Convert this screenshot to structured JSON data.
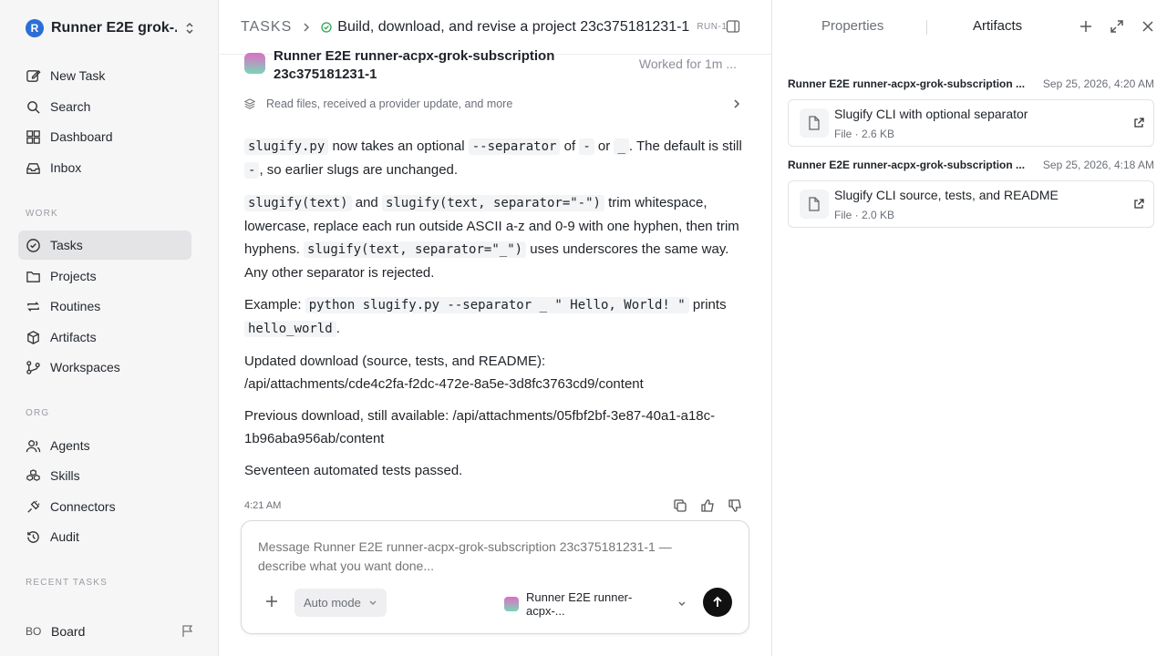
{
  "workspace": {
    "logo_letter": "R",
    "name": "Runner E2E grok-..."
  },
  "nav": {
    "new_task": "New Task",
    "search": "Search",
    "dashboard": "Dashboard",
    "inbox": "Inbox"
  },
  "sections": {
    "work": "WORK",
    "org": "ORG",
    "recent": "RECENT TASKS"
  },
  "work_nav": {
    "tasks": "Tasks",
    "projects": "Projects",
    "routines": "Routines",
    "artifacts": "Artifacts",
    "workspaces": "Workspaces"
  },
  "org_nav": {
    "agents": "Agents",
    "skills": "Skills",
    "connectors": "Connectors",
    "audit": "Audit"
  },
  "board": {
    "avatar": "BO",
    "label": "Board"
  },
  "header": {
    "crumb": "TASKS",
    "title": "Build, download, and revise a project 23c375181231-1",
    "run_id": "RUN-1"
  },
  "message": {
    "agent_name": "Runner E2E runner-acpx-grok-subscription 23c375181231-1",
    "worked_for": "Worked for 1m ...",
    "activity": "Read files, received a provider update, and more",
    "p1": {
      "c1": "slugify.py",
      "t1": " now takes an optional ",
      "c2": "--separator",
      "t2": " of ",
      "c3": "-",
      "t3": " or ",
      "c4": "_",
      "t4": ". The default is still ",
      "c5": "-",
      "t5": ", so earlier slugs are unchanged."
    },
    "p2": {
      "c1": "slugify(text)",
      "t1": " and ",
      "c2": "slugify(text, separator=\"-\")",
      "t2": " trim whitespace, lowercase, replace each run outside ASCII a-z and 0-9 with one hyphen, then trim hyphens. ",
      "c3": "slugify(text, separator=\"_\")",
      "t3": " uses underscores the same way. Any other separator is rejected."
    },
    "p3": {
      "t1": "Example: ",
      "c1": "python slugify.py --separator _ \" Hello, World! \"",
      "t2": " prints ",
      "c2": "hello_world",
      "t3": "."
    },
    "p4": {
      "line1": "Updated download (source, tests, and README):",
      "line2": "/api/attachments/cde4c2fa-f2dc-472e-8a5e-3d8fc3763cd9/content"
    },
    "p5": "Previous download, still available: /api/attachments/05fbf2bf-3e87-40a1-a18c-1b96aba956ab/content",
    "p6": "Seventeen automated tests passed.",
    "timestamp": "4:21 AM"
  },
  "composer": {
    "placeholder": "Message Runner E2E runner-acpx-grok-subscription 23c375181231-1 — describe what you want done...",
    "mode": "Auto mode",
    "agent": "Runner E2E runner-acpx-..."
  },
  "right_panel": {
    "tab_properties": "Properties",
    "tab_artifacts": "Artifacts",
    "artifacts": [
      {
        "owner": "Runner E2E runner-acpx-grok-subscription ...",
        "date": "Sep 25, 2026, 4:20 AM",
        "title": "Slugify CLI with optional separator",
        "meta": "File · 2.6 KB"
      },
      {
        "owner": "Runner E2E runner-acpx-grok-subscription ...",
        "date": "Sep 25, 2026, 4:18 AM",
        "title": "Slugify CLI source, tests, and README",
        "meta": "File · 2.0 KB"
      }
    ]
  }
}
